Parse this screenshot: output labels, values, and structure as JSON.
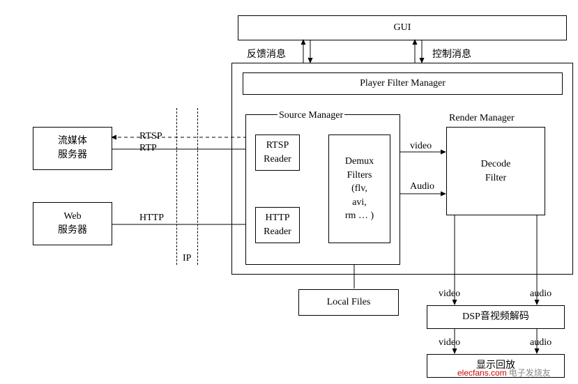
{
  "chart_data": {
    "type": "diagram",
    "title": "Streaming Media Player Architecture",
    "nodes": [
      {
        "id": "gui",
        "label": "GUI"
      },
      {
        "id": "pfm",
        "label": "Player Filter Manager"
      },
      {
        "id": "sm",
        "label": "Source Manager"
      },
      {
        "id": "rm",
        "label": "Render Manager"
      },
      {
        "id": "rtsp_reader",
        "label": "RTSP\nReader"
      },
      {
        "id": "http_reader",
        "label": "HTTP\nReader"
      },
      {
        "id": "demux",
        "label": "Demux\nFilters\n(flv,\navi,\nrm … )"
      },
      {
        "id": "decode",
        "label": "Decode\nFilter"
      },
      {
        "id": "stream_server",
        "label": "流媒体\n服务器"
      },
      {
        "id": "web_server",
        "label": "Web\n服务器"
      },
      {
        "id": "local_files",
        "label": "Local Files"
      },
      {
        "id": "dsp",
        "label": "DSP音视频解码"
      },
      {
        "id": "playback",
        "label": "显示回放"
      }
    ],
    "edges": [
      {
        "from": "gui",
        "to": "pfm",
        "label": "控制消息",
        "dir": "both"
      },
      {
        "from": "pfm",
        "to": "gui",
        "label": "反馈消息",
        "dir": "both"
      },
      {
        "from": "stream_server",
        "to": "rtsp_reader",
        "label": "RTSP",
        "style": "dashed",
        "dir": "both"
      },
      {
        "from": "stream_server",
        "to": "rtsp_reader",
        "label": "RTP",
        "dir": "forward"
      },
      {
        "from": "web_server",
        "to": "http_reader",
        "label": "HTTP",
        "dir": "forward"
      },
      {
        "from": "rtsp_reader",
        "to": "demux",
        "dir": "forward"
      },
      {
        "from": "http_reader",
        "to": "demux",
        "dir": "forward"
      },
      {
        "from": "local_files",
        "to": "demux",
        "dir": "forward"
      },
      {
        "from": "demux",
        "to": "decode",
        "label": "video",
        "dir": "forward"
      },
      {
        "from": "demux",
        "to": "decode",
        "label": "Audio",
        "dir": "forward"
      },
      {
        "from": "decode",
        "to": "dsp",
        "label": "video",
        "dir": "forward"
      },
      {
        "from": "decode",
        "to": "dsp",
        "label": "audio",
        "dir": "forward"
      },
      {
        "from": "dsp",
        "to": "playback",
        "label": "video",
        "dir": "forward"
      },
      {
        "from": "dsp",
        "to": "playback",
        "label": "audio",
        "dir": "forward"
      }
    ],
    "annotations": [
      {
        "id": "ip_boundary",
        "label": "IP",
        "style": "dashed-vertical"
      }
    ]
  },
  "labels": {
    "gui": "GUI",
    "feedback": "反馈消息",
    "control": "控制消息",
    "pfm": "Player Filter Manager",
    "sm": "Source Manager",
    "rm": "Render Manager",
    "rtsp_reader": "RTSP<br>Reader",
    "http_reader": "HTTP<br>Reader",
    "demux": "Demux<br>Filters<br>(flv,<br>avi,<br>rm … )",
    "decode": "Decode<br>Filter",
    "stream_server": "流媒体<br>服务器",
    "web_server": "Web<br>服务器",
    "rtsp": "RTSP",
    "rtp": "RTP",
    "http": "HTTP",
    "ip": "IP",
    "local_files": "Local Files",
    "video": "video",
    "audio_cap": "Audio",
    "audio": "audio",
    "dsp": "DSP音视频解码",
    "playback": "显示回放",
    "watermark": "elecfans.com",
    "watermark_cn": "电子发烧友"
  }
}
